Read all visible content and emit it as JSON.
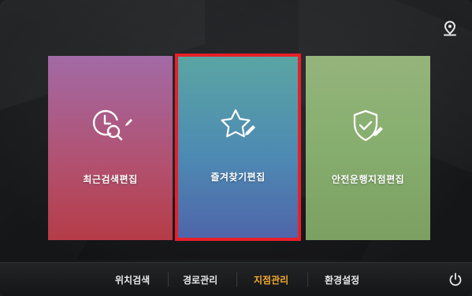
{
  "tiles": [
    {
      "label": "최근검색편집",
      "icon": "clock-search-edit-icon",
      "selected": false
    },
    {
      "label": "즐겨찾기편집",
      "icon": "star-edit-icon",
      "selected": true
    },
    {
      "label": "안전운행지점편집",
      "icon": "shield-check-edit-icon",
      "selected": false
    }
  ],
  "bottom_menu": [
    {
      "label": "위치검색",
      "active": false
    },
    {
      "label": "경로관리",
      "active": false
    },
    {
      "label": "지점관리",
      "active": true
    },
    {
      "label": "환경설정",
      "active": false
    }
  ],
  "colors": {
    "active_menu": "#f0a830",
    "selection_border": "#e8202a"
  }
}
